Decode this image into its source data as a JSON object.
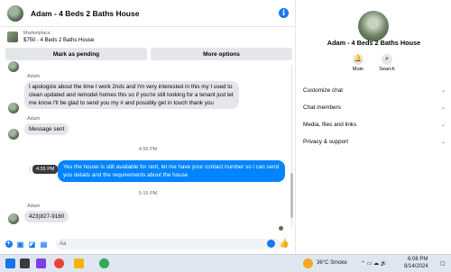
{
  "header": {
    "title": "Adam - 4 Beds 2 Baths House"
  },
  "marketplace": {
    "label": "Marketplace",
    "price_title": "$750 - 4 Beds 2 Baths House"
  },
  "actions": {
    "mark_pending": "Mark as pending",
    "more_options": "More options"
  },
  "messages": [
    {
      "sender": "Adam",
      "text": "I apologize about the time I work 2nds and I'm very interested in this my I used to clean updated and remodel homes this so if you're still looking for a tenant just let me know I'll be glad to send you my # and possibly get in touch thank you"
    },
    {
      "sender": "Adam",
      "text": "Message sent"
    },
    {
      "timestamp": "4:55 PM",
      "tooltip": "4:55 PM",
      "text": "Yes the house is still available for rent, let me have your contact number so i can send you details and the requirements about the house"
    },
    {
      "timestamp": "5:16 PM",
      "sender": "Adam",
      "text": "423)827-9160"
    }
  ],
  "composer": {
    "placeholder": "Aa"
  },
  "sidebar": {
    "name": "Adam - 4 Beds 2 Baths House",
    "mute_label": "Mute",
    "search_label": "Search",
    "items": [
      {
        "label": "Customize chat"
      },
      {
        "label": "Chat members"
      },
      {
        "label": "Media, files and links"
      },
      {
        "label": "Privacy & support"
      }
    ]
  },
  "taskbar": {
    "weather": "36°C  Smoke",
    "time": "6:08 PM",
    "date": "8/14/2024"
  },
  "colors": {
    "accent": "#0084ff",
    "bubble_in": "#e4e6eb"
  }
}
